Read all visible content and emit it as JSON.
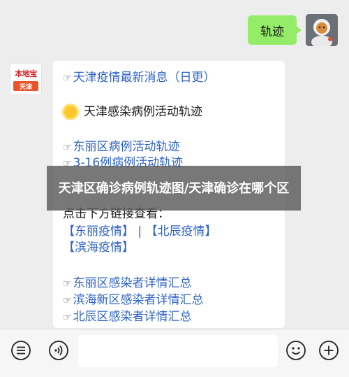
{
  "user_message": "轨迹",
  "bot_avatar": {
    "logo_text": "本地宝",
    "city": "天津"
  },
  "bot_message": {
    "lines": [
      {
        "type": "link",
        "prefix": "☞",
        "text": "天津疫情最新消息（日更）"
      },
      {
        "type": "heading",
        "text": "天津感染病例活动轨迹"
      },
      {
        "type": "link",
        "prefix": "☞",
        "text": "东丽区病例活动轨迹"
      },
      {
        "type": "link",
        "prefix": "☞",
        "text": "3-16例病例活动轨迹"
      },
      {
        "type": "plain",
        "text": "点击下方链接查看："
      },
      {
        "type": "links_row",
        "text": "【东丽疫情】 | 【北辰疫情】"
      },
      {
        "type": "links_row",
        "text": "【滨海疫情】"
      },
      {
        "type": "link",
        "prefix": "☞",
        "text": "东丽区感染者详情汇总"
      },
      {
        "type": "link",
        "prefix": "☞",
        "text": "滨海新区感染者详情汇总"
      },
      {
        "type": "link",
        "prefix": "☞",
        "text": "北辰区感染者详情汇总"
      }
    ]
  },
  "overlay_title": "天津区确诊病例轨迹图/天津确诊在哪个区",
  "input_bar": {
    "placeholder": "",
    "icons": [
      "menu-list-icon",
      "voice-icon",
      "emoji-icon",
      "plus-icon"
    ]
  },
  "colors": {
    "user_bubble": "#95ec69",
    "link": "#2f63c6",
    "background": "#ededed"
  }
}
